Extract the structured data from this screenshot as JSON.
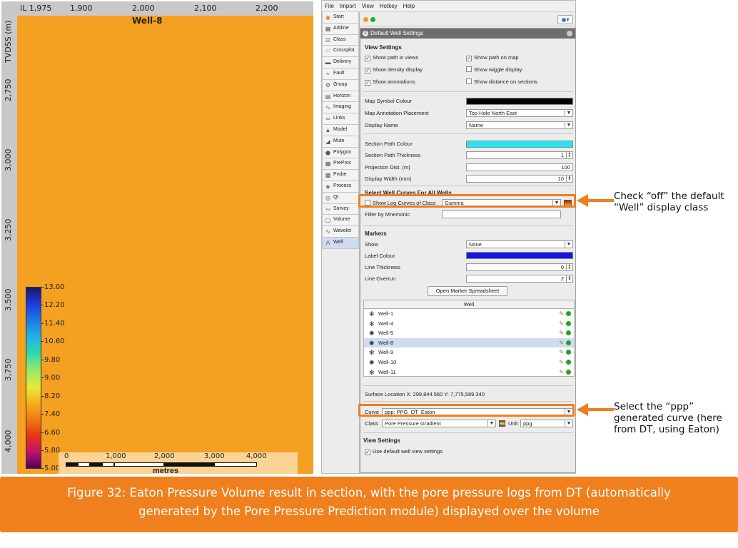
{
  "section_view": {
    "axis_top_labels": [
      "IL 1,975",
      "1,900",
      "2,000",
      "2,100",
      "2,200"
    ],
    "axis_left_title": "TVDSS (m)",
    "depth_labels": [
      "2,750",
      "3,000",
      "3,250",
      "3,500",
      "3,750",
      "4,000"
    ],
    "well_label": "Well-8",
    "colorbar_labels": [
      "13.00",
      "12.20",
      "11.40",
      "10.60",
      "9.80",
      "9.00",
      "8.20",
      "7.40",
      "6.60",
      "5.80",
      "5.00"
    ],
    "scalebar_labels": [
      "0",
      "1,000",
      "2,000",
      "3,000",
      "4,000"
    ],
    "scalebar_units": "metres"
  },
  "menubar": [
    "File",
    "Import",
    "View",
    "Hotkey",
    "Help"
  ],
  "sidebar": [
    {
      "label": "Start",
      "icon": "start-icon"
    },
    {
      "label": "Arbline",
      "icon": "arbline-icon"
    },
    {
      "label": "Class",
      "icon": "class-icon"
    },
    {
      "label": "Crossplot",
      "icon": "crossplot-icon"
    },
    {
      "label": "Delivery",
      "icon": "delivery-icon"
    },
    {
      "label": "Fault",
      "icon": "fault-icon"
    },
    {
      "label": "Group",
      "icon": "group-icon"
    },
    {
      "label": "Horizon",
      "icon": "horizon-icon"
    },
    {
      "label": "Imaging",
      "icon": "imaging-icon"
    },
    {
      "label": "Links",
      "icon": "links-icon"
    },
    {
      "label": "Model",
      "icon": "model-icon"
    },
    {
      "label": "Mute",
      "icon": "mute-icon"
    },
    {
      "label": "Polygon",
      "icon": "polygon-icon"
    },
    {
      "label": "PreProc",
      "icon": "preproc-icon"
    },
    {
      "label": "Probe",
      "icon": "probe-icon"
    },
    {
      "label": "Process",
      "icon": "process-icon"
    },
    {
      "label": "QI",
      "icon": "qi-icon"
    },
    {
      "label": "Survey",
      "icon": "survey-icon"
    },
    {
      "label": "Volume",
      "icon": "volume-icon"
    },
    {
      "label": "Wavelet",
      "icon": "wavelet-icon"
    },
    {
      "label": "Well",
      "icon": "well-icon"
    }
  ],
  "settings": {
    "title": "Default Well Settings",
    "view_settings_heading": "View Settings",
    "checkboxes": [
      {
        "label": "Show path in views",
        "checked": true
      },
      {
        "label": "Show path on map",
        "checked": true
      },
      {
        "label": "Show density display",
        "checked": true
      },
      {
        "label": "Show wiggle display",
        "checked": false
      },
      {
        "label": "Show annotations",
        "checked": true
      },
      {
        "label": "Show distance on sections",
        "checked": false
      }
    ],
    "map_symbol_colour_label": "Map Symbol Colour",
    "map_symbol_colour": "#000000",
    "map_annotation_placement_label": "Map Annotation Placement",
    "map_annotation_placement_value": "Top Hole North East",
    "display_name_label": "Display Name",
    "display_name_value": "Name",
    "section_path_colour_label": "Section Path Colour",
    "section_path_colour": "#22e8f0",
    "section_path_thickness_label": "Section Path Thickness",
    "section_path_thickness_value": "1",
    "projection_dist_label": "Projection Dist. (m)",
    "projection_dist_value": "100",
    "display_width_label": "Display Width (mm)",
    "display_width_value": "10",
    "select_curves_heading": "Select Well Curves For All Wells",
    "show_log_curves_label": "Show Log Curves of Class",
    "show_log_curves_value": "Gamma",
    "filter_label": "Filter by Mnemonic",
    "filter_value": "",
    "markers_heading": "Markers",
    "markers_show_label": "Show",
    "markers_show_value": "None",
    "label_colour_label": "Label Colour",
    "label_colour": "#1616e0",
    "line_thickness_label": "Line Thickness",
    "line_thickness_value": "0",
    "line_overrun_label": "Line Overrun",
    "line_overrun_value": "2",
    "open_marker_button": "Open Marker Spreadsheet",
    "well_table_header": "Well",
    "wells": [
      "Well-1",
      "Well-4",
      "Well-5",
      "Well-8",
      "Well-9",
      "Well-10",
      "Well-11"
    ],
    "selected_well": "Well-8",
    "surface_location": "Surface Location X: 299,844.560   Y: 7,775,589.340",
    "curve_label": "Curve",
    "curve_value": "ppp: PPG_DT_Eaton",
    "class_label": "Class",
    "class_value": "Pore Pressure Gradient",
    "unit_label": "Unit",
    "unit_value": "ppg",
    "view_settings2_heading": "View Settings",
    "use_default_label": "Use default well view settings"
  },
  "callouts": {
    "top": [
      "Check “off” the default",
      "“Well” display class"
    ],
    "bottom": [
      "Select the “ppp”",
      "generated curve (here",
      "from DT, using Eaton)"
    ]
  },
  "caption": [
    "Figure 32: Eaton Pressure Volume result in section, with the pore pressure logs from DT (automatically",
    "generated by the Pore Pressure Prediction module) displayed over the volume"
  ],
  "colors": {
    "highlight": "#f07e1e",
    "caption_bg": "#f07f1e"
  }
}
